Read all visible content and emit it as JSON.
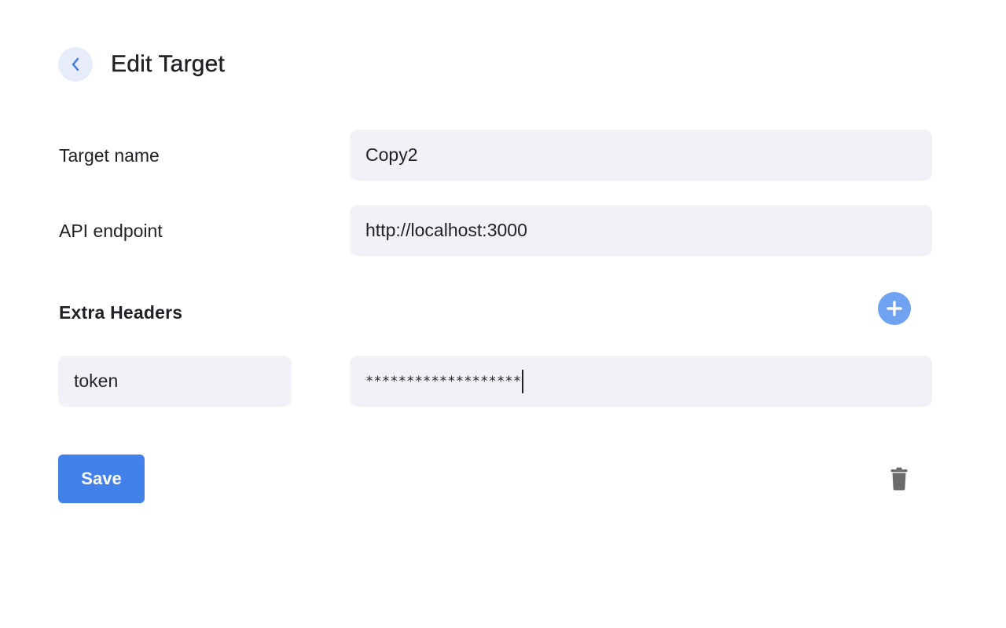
{
  "header": {
    "title": "Edit Target",
    "back_icon": "chevron-left-icon"
  },
  "form": {
    "target_name": {
      "label": "Target name",
      "value": "Copy2"
    },
    "api_endpoint": {
      "label": "API endpoint",
      "value": "http://localhost:3000"
    }
  },
  "extra_headers": {
    "title": "Extra Headers",
    "add_icon": "plus-circle-icon",
    "rows": [
      {
        "key": "token",
        "value_masked": "*******************"
      }
    ]
  },
  "actions": {
    "save_label": "Save",
    "delete_icon": "trash-icon"
  },
  "colors": {
    "accent": "#4281ea",
    "add_button": "#6fa2f0",
    "back_button_bg": "#e6ecf9",
    "field_bg": "#f1f2f7",
    "text": "#1f2126",
    "icon_gray": "#6b6b6b"
  }
}
